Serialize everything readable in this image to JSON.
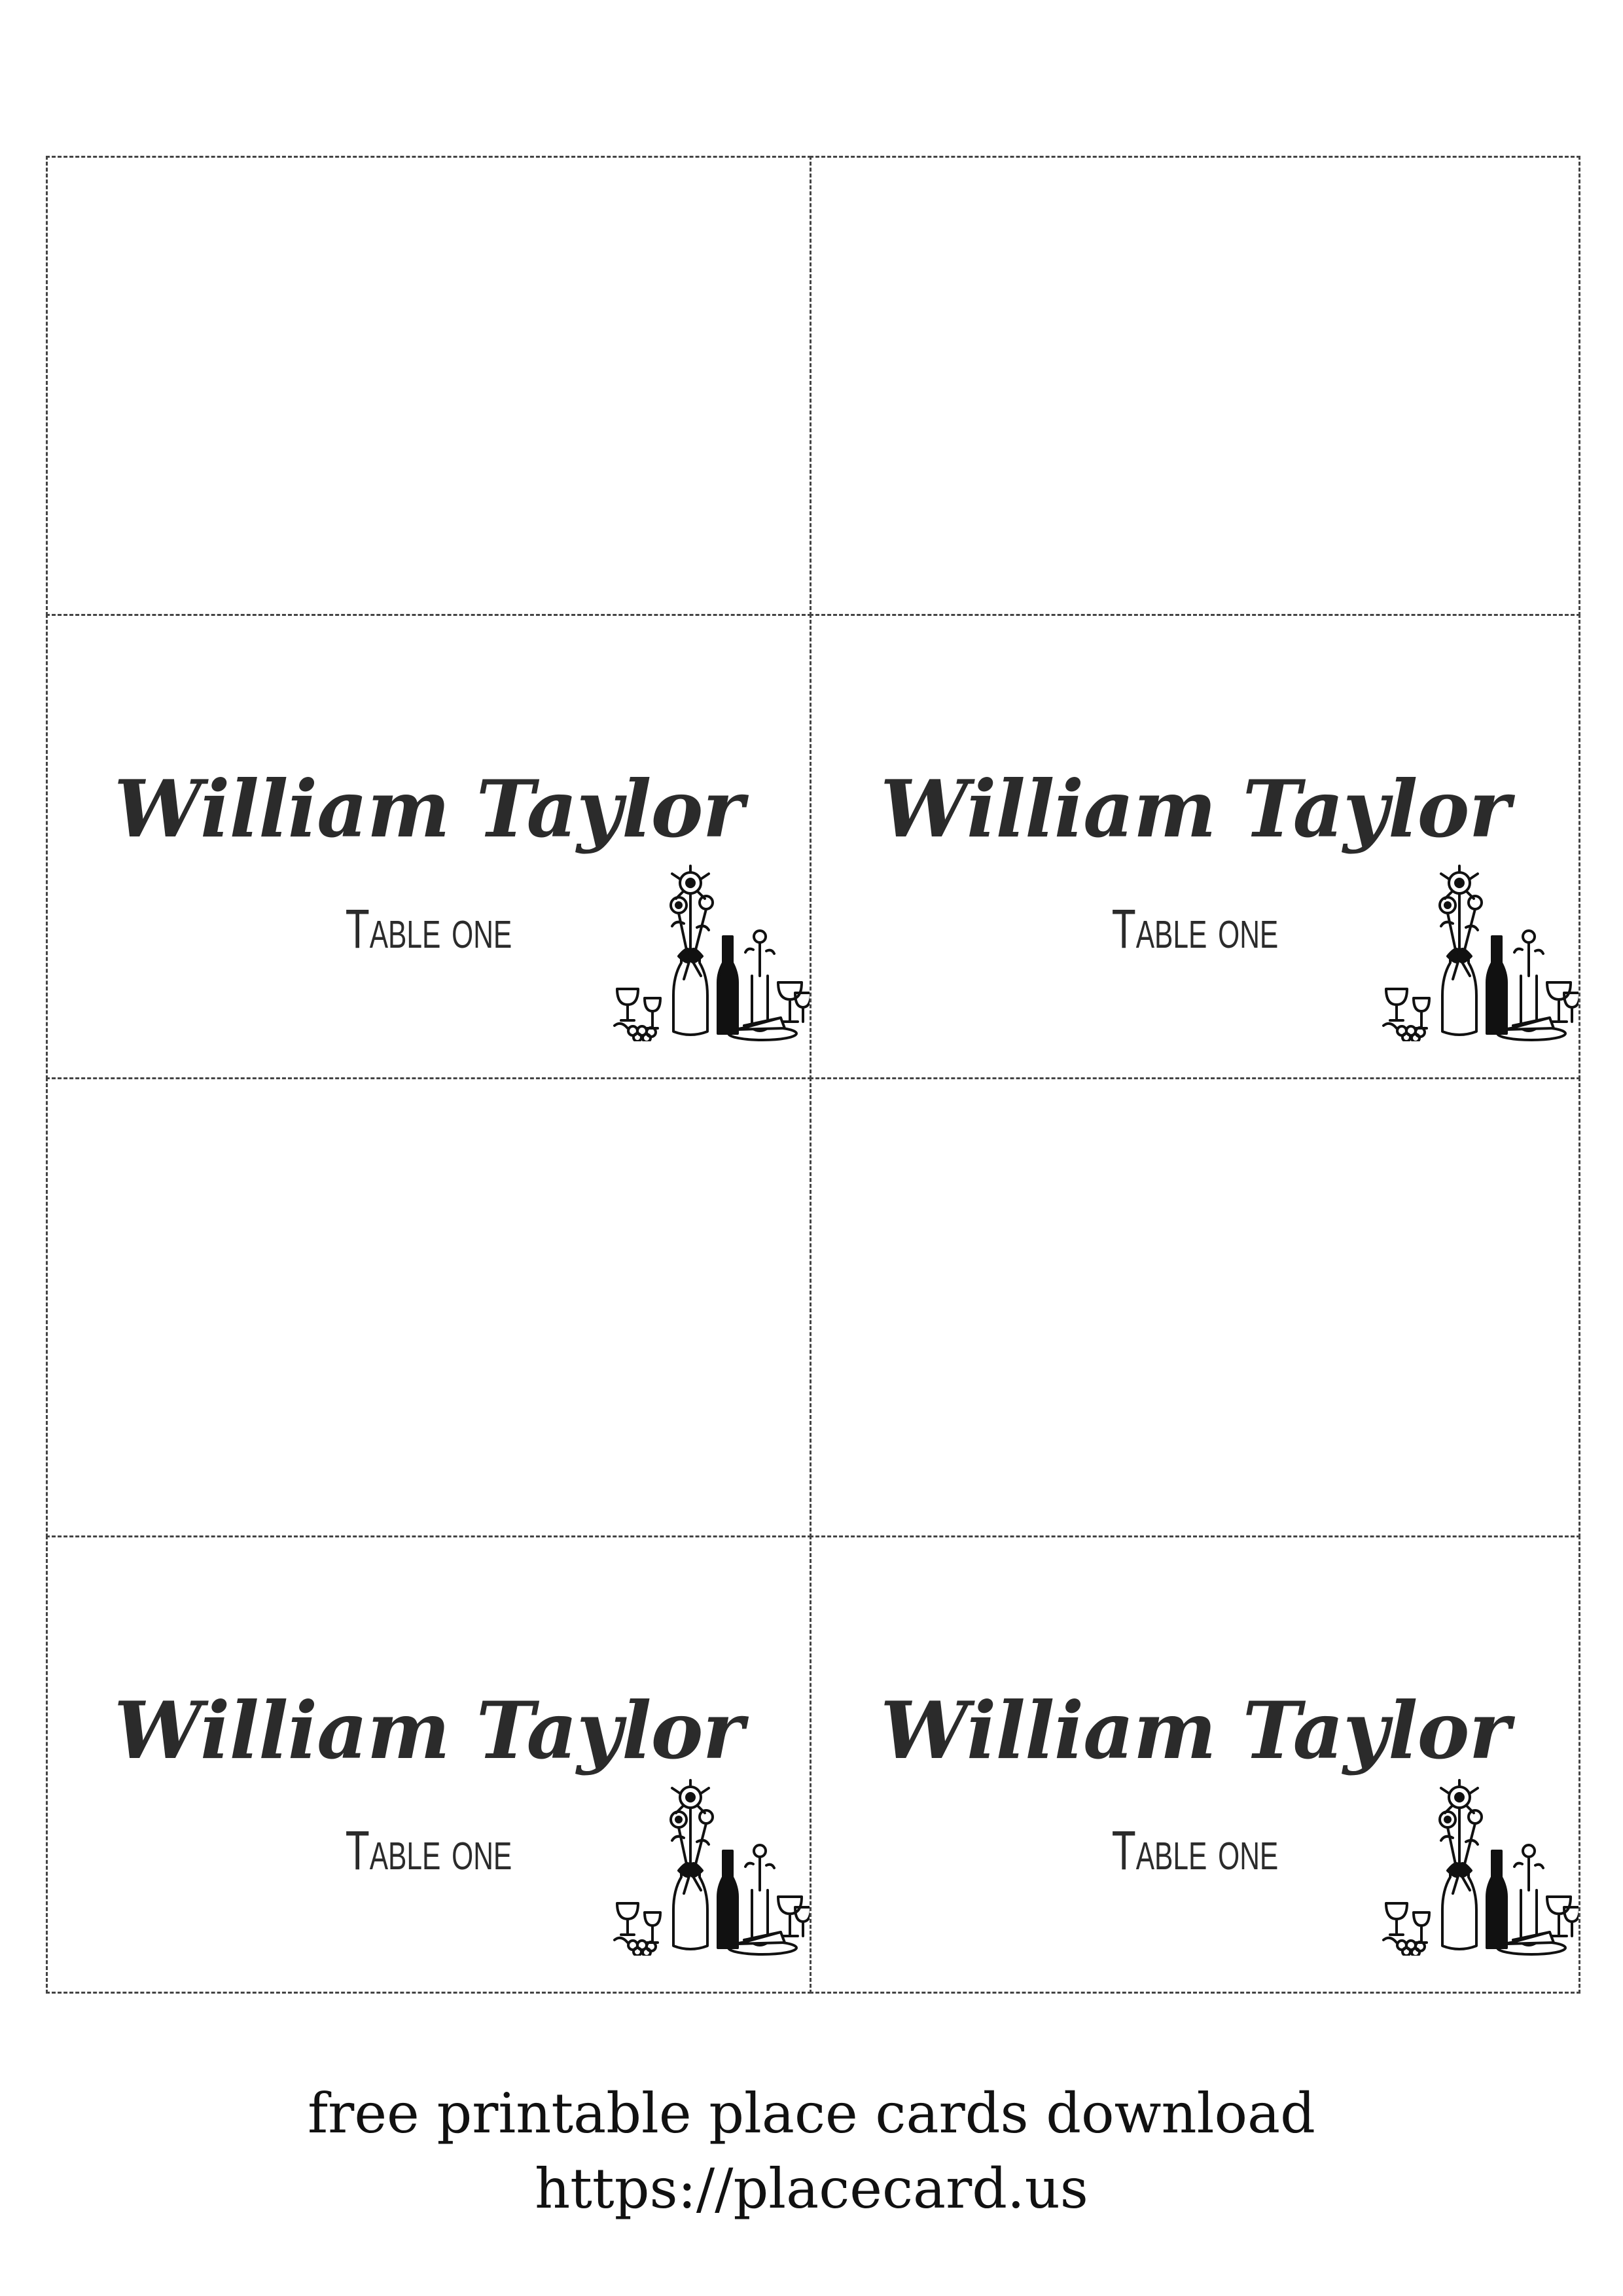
{
  "cards": [
    {
      "name": "",
      "table": ""
    },
    {
      "name": "",
      "table": ""
    },
    {
      "name": "William Taylor",
      "table": "Table one",
      "illustration": "table-setting-icon"
    },
    {
      "name": "William Taylor",
      "table": "Table one",
      "illustration": "table-setting-icon"
    },
    {
      "name": "",
      "table": ""
    },
    {
      "name": "",
      "table": ""
    },
    {
      "name": "William Taylor",
      "table": "Table one",
      "illustration": "table-setting-icon"
    },
    {
      "name": "William Taylor",
      "table": "Table one",
      "illustration": "table-setting-icon"
    }
  ],
  "footer": {
    "line1": "free printable place cards download",
    "line2": "https://placecard.us"
  },
  "colors": {
    "text": "#2b2b2b",
    "cut_line": "#444444",
    "background": "#ffffff"
  }
}
